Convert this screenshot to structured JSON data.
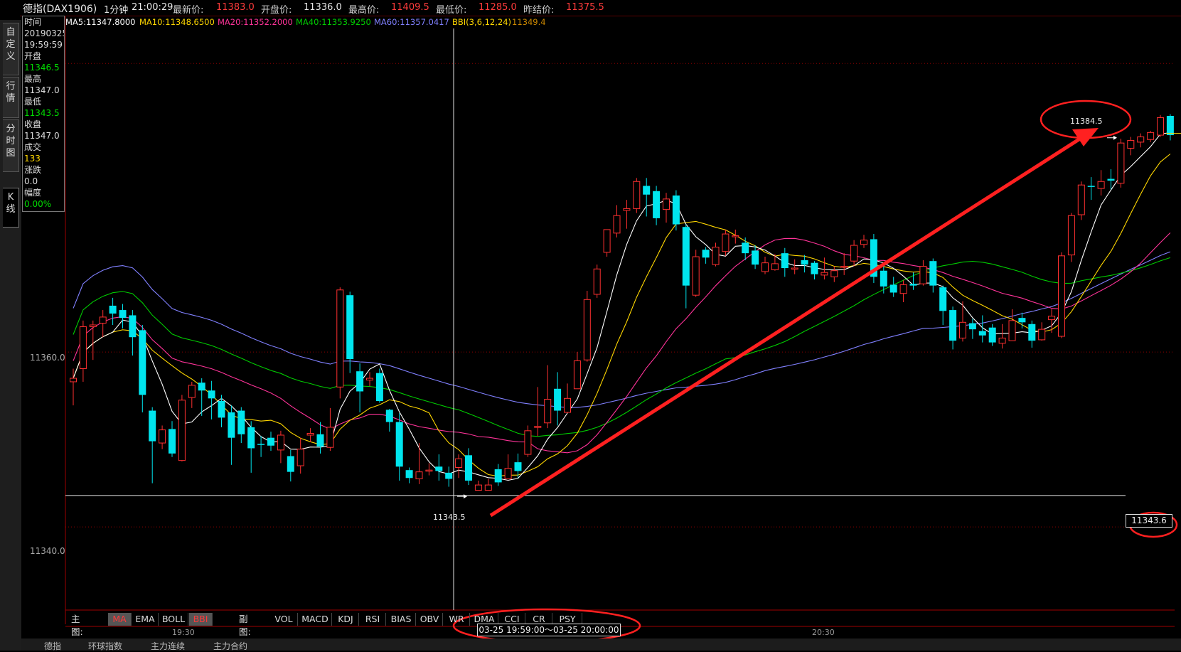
{
  "title": {
    "name": "德指(DAX1906)",
    "period": "1分钟",
    "time": "21:00:29",
    "latest_label": "最新价:",
    "latest_value": "11383.0",
    "open_label": "开盘价:",
    "open_value": "11336.0",
    "high_label": "最高价:",
    "high_value": "11409.5",
    "low_label": "最低价:",
    "low_value": "11285.0",
    "prev_label": "昨结价:",
    "prev_value": "11375.5"
  },
  "ma_legend": [
    {
      "text": "MA5:11347.8000",
      "color": "#ffffff"
    },
    {
      "text": "MA10:11348.6500",
      "color": "#ffd700"
    },
    {
      "text": "MA20:11352.2000",
      "color": "#ff3399"
    },
    {
      "text": "MA40:11353.9250",
      "color": "#00cc00"
    },
    {
      "text": "MA60:11357.0417",
      "color": "#8080ff"
    },
    {
      "text": "BBI(3,6,12,24)",
      "color": "#ffd700"
    },
    {
      "text": "11349.4",
      "color": "#cc8800"
    }
  ],
  "sidebar": {
    "tabs": [
      {
        "label": "自定义"
      },
      {
        "label": "行情"
      },
      {
        "label": "分时图"
      },
      {
        "label": "K线"
      }
    ]
  },
  "info": {
    "time_label": "时间",
    "date": "20190325",
    "time": "19:59:59",
    "open_label": "开盘",
    "open": "11346.5",
    "high_label": "最高",
    "high": "11347.0",
    "low_label": "最低",
    "low": "11343.5",
    "close_label": "收盘",
    "close": "11347.0",
    "volume_label": "成交",
    "volume": "133",
    "change_label": "涨跌",
    "change": "0.0",
    "pct_label": "幅度",
    "pct": "0.00%"
  },
  "y_axis": {
    "label_high": "11360.0",
    "label_low": "11340.0"
  },
  "annotations": {
    "max_label": "11384.5",
    "min_label": "11343.5",
    "price_tag": "11343.6",
    "cross_time": "03-25  19:59:00～03-25 20:00:00"
  },
  "toolbar": {
    "main_label": "主图:",
    "main_items": [
      {
        "label": "MA",
        "active": true
      },
      {
        "label": "EMA",
        "active": false
      },
      {
        "label": "BOLL",
        "active": false
      },
      {
        "label": "BBI",
        "active": true
      }
    ],
    "sub_label": "副图:",
    "sub_items": [
      {
        "label": "VOL"
      },
      {
        "label": "MACD"
      },
      {
        "label": "KDJ"
      },
      {
        "label": "RSI"
      },
      {
        "label": "BIAS"
      },
      {
        "label": "OBV"
      },
      {
        "label": "WR"
      },
      {
        "label": "DMA"
      },
      {
        "label": "CCI"
      },
      {
        "label": "CR"
      },
      {
        "label": "PSY"
      }
    ]
  },
  "time_axis": {
    "tick1": "19:30",
    "tick2": "20:30"
  },
  "bottom_tabs": [
    "德指",
    "环球指数",
    "主力连续",
    "主力合约"
  ],
  "colors": {
    "up": "#ff3030",
    "down": "#00e5ee",
    "ma5": "#ffffff",
    "ma10": "#ffd700",
    "ma20": "#ff3399",
    "ma40": "#00cc00",
    "ma60": "#8080ff",
    "annotation": "#ff2020"
  },
  "chart_data": {
    "type": "candlestick",
    "y_range": [
      11330.5,
      11397.0
    ],
    "y_ticks": [
      11340.0,
      11360.0
    ],
    "candles": [
      [
        11356.6,
        11357.0,
        11358.1,
        11353.9
      ],
      [
        11358.1,
        11362.9,
        11363.6,
        11356.6
      ],
      [
        11362.9,
        11363.1,
        11363.6,
        11359.1
      ],
      [
        11363.3,
        11364.0,
        11364.8,
        11361.7
      ],
      [
        11365.3,
        11364.4,
        11366.2,
        11363.1
      ],
      [
        11364.8,
        11363.9,
        11365.5,
        11362.7
      ],
      [
        11364.2,
        11361.7,
        11364.8,
        11359.6
      ],
      [
        11362.5,
        11355.1,
        11363.1,
        11353.1
      ],
      [
        11353.3,
        11349.8,
        11353.7,
        11345.0
      ],
      [
        11349.6,
        11351.1,
        11351.6,
        11348.9
      ],
      [
        11351.2,
        11348.4,
        11352.1,
        11348.0
      ],
      [
        11347.6,
        11354.5,
        11355.1,
        11347.5
      ],
      [
        11354.8,
        11356.2,
        11356.6,
        11353.6
      ],
      [
        11356.5,
        11355.6,
        11357.0,
        11352.7
      ],
      [
        11355.6,
        11354.7,
        11356.7,
        11352.3
      ],
      [
        11354.4,
        11352.5,
        11355.1,
        11351.4
      ],
      [
        11353.1,
        11350.2,
        11353.9,
        11347.1
      ],
      [
        11353.3,
        11350.6,
        11353.7,
        11349.6
      ],
      [
        11351.4,
        11349.0,
        11352.1,
        11346.2
      ],
      [
        11349.5,
        11349.4,
        11350.4,
        11348.0
      ],
      [
        11350.2,
        11349.3,
        11350.9,
        11348.7
      ],
      [
        11348.8,
        11350.5,
        11351.0,
        11347.3
      ],
      [
        11348.1,
        11346.3,
        11348.8,
        11345.2
      ],
      [
        11347.0,
        11348.9,
        11350.2,
        11346.1
      ],
      [
        11350.5,
        11350.7,
        11351.3,
        11349.7
      ],
      [
        11350.6,
        11349.2,
        11352.0,
        11348.4
      ],
      [
        11349.1,
        11351.4,
        11353.6,
        11348.7
      ],
      [
        11356.0,
        11367.1,
        11367.4,
        11354.7
      ],
      [
        11366.5,
        11359.2,
        11366.9,
        11357.6
      ],
      [
        11357.8,
        11355.5,
        11358.7,
        11353.1
      ],
      [
        11356.8,
        11357.0,
        11357.7,
        11356.1
      ],
      [
        11357.6,
        11354.4,
        11358.1,
        11354.2
      ],
      [
        11353.4,
        11352.0,
        11353.5,
        11350.9
      ],
      [
        11352.0,
        11346.9,
        11353.0,
        11345.3
      ],
      [
        11346.5,
        11345.6,
        11346.8,
        11345.0
      ],
      [
        11345.5,
        11346.3,
        11349.6,
        11344.9
      ],
      [
        11346.5,
        11346.5,
        11347.3,
        11345.9
      ],
      [
        11346.9,
        11346.4,
        11348.3,
        11345.3
      ],
      [
        11346.2,
        11345.5,
        11346.9,
        11344.6
      ],
      [
        11346.8,
        11347.8,
        11348.3,
        11345.6
      ],
      [
        11348.2,
        11345.3,
        11349.0,
        11344.8
      ],
      [
        11344.2,
        11344.8,
        11345.3,
        11344.2
      ],
      [
        11344.2,
        11344.8,
        11345.5,
        11344.2
      ],
      [
        11346.6,
        11345.1,
        11347.2,
        11344.7
      ],
      [
        11345.5,
        11346.7,
        11348.3,
        11345.6
      ],
      [
        11347.4,
        11346.4,
        11348.4,
        11345.6
      ],
      [
        11348.3,
        11351.0,
        11351.6,
        11348.0
      ],
      [
        11351.4,
        11351.5,
        11356.0,
        11350.4
      ],
      [
        11351.9,
        11354.6,
        11358.5,
        11351.3
      ],
      [
        11355.8,
        11353.3,
        11357.7,
        11351.6
      ],
      [
        11353.1,
        11354.7,
        11356.4,
        11353.0
      ],
      [
        11355.8,
        11359.0,
        11360.0,
        11355.8
      ],
      [
        11359.1,
        11366.0,
        11367.0,
        11358.9
      ],
      [
        11366.6,
        11369.5,
        11370.0,
        11366.2
      ],
      [
        11371.4,
        11374.0,
        11374.0,
        11370.9
      ],
      [
        11373.6,
        11375.6,
        11376.8,
        11373.1
      ],
      [
        11376.2,
        11376.4,
        11377.4,
        11374.1
      ],
      [
        11376.4,
        11379.5,
        11379.9,
        11375.9
      ],
      [
        11379.0,
        11378.0,
        11379.9,
        11375.5
      ],
      [
        11378.4,
        11375.3,
        11379.0,
        11374.5
      ],
      [
        11376.3,
        11377.5,
        11378.2,
        11374.8
      ],
      [
        11377.9,
        11374.6,
        11378.5,
        11373.9
      ],
      [
        11374.3,
        11367.6,
        11374.6,
        11365.0
      ],
      [
        11366.5,
        11370.9,
        11371.7,
        11366.3
      ],
      [
        11371.7,
        11370.8,
        11372.0,
        11370.1
      ],
      [
        11370.0,
        11372.0,
        11372.5,
        11369.8
      ],
      [
        11371.5,
        11373.5,
        11374.0,
        11371.0
      ],
      [
        11373.3,
        11373.3,
        11374.0,
        11372.4
      ],
      [
        11372.5,
        11371.3,
        11373.1,
        11370.5
      ],
      [
        11371.6,
        11370.0,
        11372.2,
        11369.5
      ],
      [
        11369.2,
        11370.2,
        11370.9,
        11368.9
      ],
      [
        11369.4,
        11370.1,
        11371.2,
        11369.3
      ],
      [
        11371.3,
        11369.6,
        11371.9,
        11368.6
      ],
      [
        11369.6,
        11369.6,
        11370.6,
        11368.9
      ],
      [
        11370.5,
        11370.0,
        11371.1,
        11369.1
      ],
      [
        11370.2,
        11368.9,
        11370.4,
        11368.3
      ],
      [
        11368.8,
        11369.1,
        11370.8,
        11368.3
      ],
      [
        11368.6,
        11369.3,
        11369.8,
        11368.0
      ],
      [
        11369.7,
        11369.8,
        11371.3,
        11368.8
      ],
      [
        11370.4,
        11372.2,
        11372.8,
        11369.8
      ],
      [
        11372.3,
        11372.8,
        11373.4,
        11371.9
      ],
      [
        11372.9,
        11368.6,
        11373.5,
        11367.9
      ],
      [
        11369.3,
        11367.5,
        11369.9,
        11366.7
      ],
      [
        11367.7,
        11366.8,
        11368.6,
        11366.3
      ],
      [
        11366.7,
        11367.7,
        11368.2,
        11365.7
      ],
      [
        11367.8,
        11367.6,
        11369.1,
        11367.1
      ],
      [
        11367.8,
        11369.8,
        11370.5,
        11367.6
      ],
      [
        11370.4,
        11367.6,
        11370.7,
        11366.8
      ],
      [
        11367.4,
        11364.7,
        11367.6,
        11363.1
      ],
      [
        11364.8,
        11361.3,
        11365.2,
        11360.3
      ],
      [
        11361.6,
        11363.4,
        11365.8,
        11361.2
      ],
      [
        11363.3,
        11362.6,
        11363.8,
        11361.5
      ],
      [
        11362.4,
        11361.9,
        11364.2,
        11361.1
      ],
      [
        11362.8,
        11361.1,
        11363.2,
        11360.7
      ],
      [
        11361.0,
        11361.6,
        11363.2,
        11360.4
      ],
      [
        11361.3,
        11363.6,
        11364.9,
        11361.3
      ],
      [
        11363.9,
        11363.4,
        11364.5,
        11362.7
      ],
      [
        11363.2,
        11361.3,
        11363.6,
        11360.5
      ],
      [
        11361.4,
        11362.6,
        11363.4,
        11361.3
      ],
      [
        11363.7,
        11364.1,
        11364.9,
        11362.2
      ],
      [
        11361.8,
        11371.0,
        11371.4,
        11361.6
      ],
      [
        11371.1,
        11375.6,
        11375.9,
        11370.3
      ],
      [
        11375.7,
        11379.1,
        11379.5,
        11375.1
      ],
      [
        11379.0,
        11378.9,
        11380.0,
        11377.4
      ],
      [
        11378.7,
        11379.5,
        11380.8,
        11377.9
      ],
      [
        11379.8,
        11379.6,
        11380.9,
        11378.6
      ],
      [
        11379.3,
        11383.9,
        11384.4,
        11378.8
      ],
      [
        11383.3,
        11384.2,
        11384.6,
        11382.5
      ],
      [
        11384.0,
        11384.6,
        11385.0,
        11383.4
      ],
      [
        11384.3,
        11385.1,
        11385.3,
        11384.0
      ],
      [
        11384.8,
        11386.8,
        11387.1,
        11384.6
      ],
      [
        11387.0,
        11384.8,
        11387.2,
        11384.2
      ]
    ]
  }
}
